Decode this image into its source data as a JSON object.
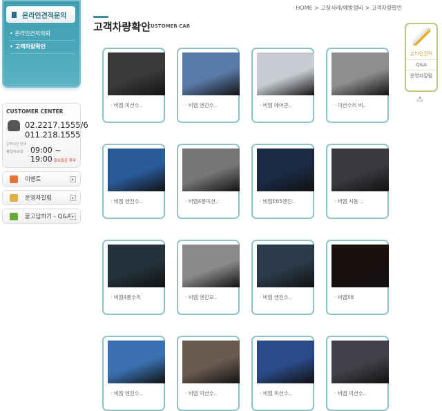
{
  "sidebar": {
    "title": "온라인견적문의",
    "links": [
      "온라인견적의뢰",
      "고객차량확인"
    ]
  },
  "customer_center": {
    "title": "CUSTOMER CENTER",
    "phone1": "02.2217.1555/6",
    "phone2": "011.218.1555",
    "hours_label": "근무시간 안내",
    "days_label": "평일/토요일",
    "hours": "09:00 ~ 19:00",
    "closed": "일요일은 휴무"
  },
  "quick_buttons": [
    {
      "label": "이벤트",
      "color": "#e8743a"
    },
    {
      "label": "운영자칼럼",
      "color": "#e0b040"
    },
    {
      "label": "묻고답하기 - Q&A",
      "color": "#6aaa3a"
    }
  ],
  "breadcrumb": "· HOME > 고장사례/예방정비 > 고객차량확인",
  "page": {
    "title": "고객차량확인",
    "subtitle": "CUSTOMER CAR"
  },
  "cards": [
    {
      "caption": "· 비엠 미션수..",
      "color": "#3a3a3a"
    },
    {
      "caption": "· 비엠 엔진수..",
      "color": "#5a7aa8"
    },
    {
      "caption": "· 비엠 에어콘..",
      "color": "#c8ccd2"
    },
    {
      "caption": "· 미션수리 비..",
      "color": "#8e8e8e"
    },
    {
      "caption": "· 비엠 엔진수..",
      "color": "#2a5a9a"
    },
    {
      "caption": "· 비엠4륜미션..",
      "color": "#777"
    },
    {
      "caption": "· 비엠E65엔진..",
      "color": "#1a2a44"
    },
    {
      "caption": "· 비엠 시동 ..",
      "color": "#3a3a40"
    },
    {
      "caption": "· 비엠4륜수리",
      "color": "#23323a"
    },
    {
      "caption": "· 비엠 엔진오..",
      "color": "#8a8a88"
    },
    {
      "caption": "· 비엠 엔진수..",
      "color": "#2a3a48"
    },
    {
      "caption": "· 비엠X6",
      "color": "#1a1010"
    },
    {
      "caption": "· 비엠 엔진수..",
      "color": "#3a70b0"
    },
    {
      "caption": "· 비엠 미션수..",
      "color": "#6a5a50"
    },
    {
      "caption": "· 비엠 미션수..",
      "color": "#2a4a88"
    },
    {
      "caption": "· 비엠 미션수..",
      "color": "#404048"
    }
  ],
  "quick_menu": {
    "items": [
      "온라인견적",
      "Q&A",
      "운영자칼럼"
    ],
    "top": "TOP"
  }
}
